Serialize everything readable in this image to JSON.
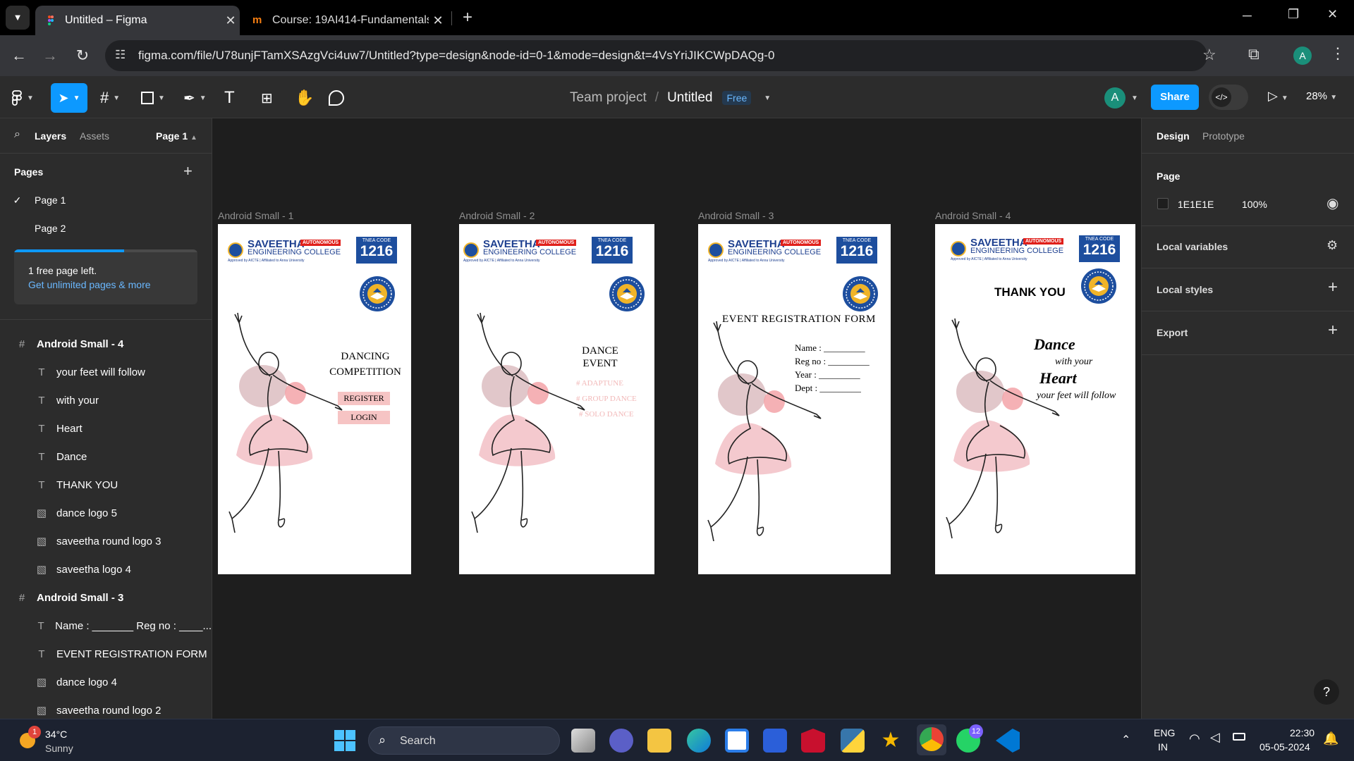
{
  "browser": {
    "tabs": [
      {
        "title": "Untitled – Figma",
        "active": true
      },
      {
        "title": "Course: 19AI414-Fundamentals",
        "active": false
      }
    ],
    "url": "figma.com/file/U78unjFTamXSAzgVci4uw7/Untitled?type=design&node-id=0-1&mode=design&t=4VsYriJIKCWpDAQg-0",
    "profile_initial": "A"
  },
  "toolbar": {
    "project": "Team project",
    "separator": "/",
    "file": "Untitled",
    "plan": "Free",
    "avatar": "A",
    "share": "Share",
    "zoom": "28%"
  },
  "left": {
    "tabs": {
      "layers": "Layers",
      "assets": "Assets",
      "page_selector": "Page 1"
    },
    "pages_title": "Pages",
    "pages": [
      "Page 1",
      "Page 2"
    ],
    "upsell": {
      "text": "1 free page left.",
      "link": "Get unlimited pages & more",
      "progress": 0.6
    },
    "layers": [
      {
        "name": "Android Small - 4",
        "type": "frame"
      },
      {
        "name": "your feet will follow",
        "type": "text"
      },
      {
        "name": "with your",
        "type": "text"
      },
      {
        "name": "Heart",
        "type": "text"
      },
      {
        "name": "Dance",
        "type": "text"
      },
      {
        "name": "THANK YOU",
        "type": "text"
      },
      {
        "name": "dance logo 5",
        "type": "image"
      },
      {
        "name": "saveetha round logo 3",
        "type": "image"
      },
      {
        "name": "saveetha logo 4",
        "type": "image"
      },
      {
        "name": "Android Small - 3",
        "type": "frame"
      },
      {
        "name": "Name : _______ Reg no : ____...",
        "type": "text"
      },
      {
        "name": "EVENT REGISTRATION FORM",
        "type": "text"
      },
      {
        "name": "dance logo 4",
        "type": "image"
      },
      {
        "name": "saveetha round logo 2",
        "type": "image"
      }
    ]
  },
  "right": {
    "tabs": {
      "design": "Design",
      "prototype": "Prototype"
    },
    "page_title": "Page",
    "bg_hex": "1E1E1E",
    "bg_opacity": "100%",
    "bg_color": "#1E1E1E",
    "local_variables": "Local variables",
    "local_styles": "Local styles",
    "export": "Export"
  },
  "frames": [
    {
      "label": "Android Small - 1"
    },
    {
      "label": "Android Small - 2"
    },
    {
      "label": "Android Small - 3"
    },
    {
      "label": "Android Small - 4"
    }
  ],
  "college": {
    "name1": "SAVEETHA",
    "name2": "ENGINEERING COLLEGE",
    "badge": "AUTONOMOUS",
    "sub": "Approved by AICTE | Affiliated to Anna University",
    "code_label": "TNEA CODE",
    "code": "1216"
  },
  "f1": {
    "title1": "DANCING",
    "title2": "COMPETITION",
    "register": "REGISTER",
    "login": "LOGIN"
  },
  "f2": {
    "title1": "DANCE",
    "title2": "EVENT",
    "items": [
      "# ADAPTUNE",
      "# GROUP DANCE",
      "# SOLO DANCE"
    ]
  },
  "f3": {
    "title": "EVENT REGISTRATION FORM",
    "fields": [
      "Name : _________",
      "Reg no : _________",
      "Year : _________",
      "Dept : _________"
    ]
  },
  "f4": {
    "thanks": "THANK YOU",
    "l1": "Dance",
    "l2": "with your",
    "l3": "Heart",
    "l4": "your feet will follow"
  },
  "taskbar": {
    "temp": "34°C",
    "weather": "Sunny",
    "weather_badge": "1",
    "search": "Search",
    "lang1": "ENG",
    "lang2": "IN",
    "time": "22:30",
    "date": "05-05-2024",
    "whatsapp_badge": "12"
  },
  "accent": "#0d99ff"
}
